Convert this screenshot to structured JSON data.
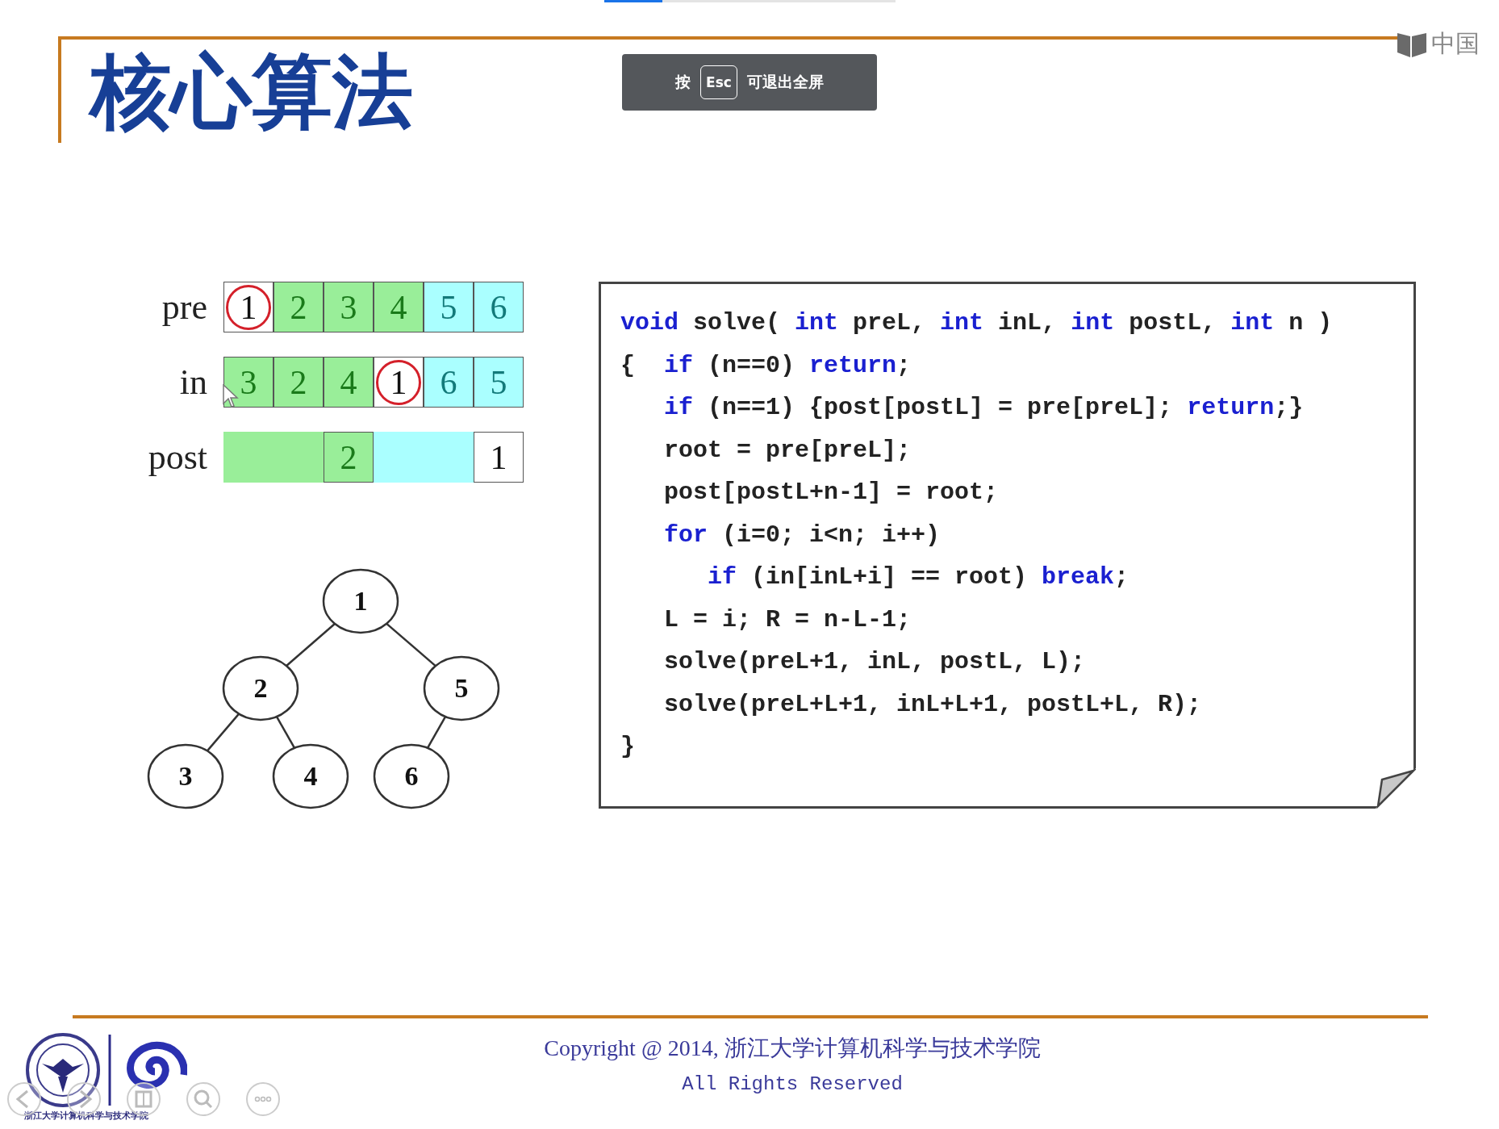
{
  "top_bar": {
    "level": 0.2
  },
  "fullscreen_hint": {
    "before": "按",
    "key": "Esc",
    "after": "可退出全屏"
  },
  "corner_logo": {
    "text": "中国"
  },
  "slide": {
    "title": "核心算法",
    "arrays": [
      {
        "label": "pre",
        "cells": [
          {
            "text": "1",
            "color": "#ffffff",
            "circled": true,
            "bordered": true
          },
          {
            "text": "2",
            "color": "#99ee99",
            "circled": false,
            "bordered": true
          },
          {
            "text": "3",
            "color": "#99ee99",
            "circled": false,
            "bordered": true
          },
          {
            "text": "4",
            "color": "#99ee99",
            "circled": false,
            "bordered": true
          },
          {
            "text": "5",
            "color": "#aaffff",
            "circled": false,
            "bordered": true
          },
          {
            "text": "6",
            "color": "#aaffff",
            "circled": false,
            "bordered": true
          }
        ]
      },
      {
        "label": "in",
        "cells": [
          {
            "text": "3",
            "color": "#99ee99",
            "circled": false,
            "bordered": true
          },
          {
            "text": "2",
            "color": "#99ee99",
            "circled": false,
            "bordered": true
          },
          {
            "text": "4",
            "color": "#99ee99",
            "circled": false,
            "bordered": true
          },
          {
            "text": "1",
            "color": "#ffffff",
            "circled": true,
            "bordered": true
          },
          {
            "text": "6",
            "color": "#aaffff",
            "circled": false,
            "bordered": true
          },
          {
            "text": "5",
            "color": "#aaffff",
            "circled": false,
            "bordered": true
          }
        ]
      },
      {
        "label": "post",
        "cells": [
          {
            "color": "#99ee99",
            "circled": false,
            "bordered": false
          },
          {
            "color": "#99ee99",
            "circled": false,
            "bordered": false
          },
          {
            "text": "2",
            "color": "#99ee99",
            "circled": false,
            "bordered": true
          },
          {
            "color": "#aaffff",
            "circled": false,
            "bordered": false
          },
          {
            "color": "#aaffff",
            "circled": false,
            "bordered": false
          },
          {
            "text": "1",
            "color": "#ffffff",
            "circled": false,
            "bordered": true
          }
        ]
      }
    ],
    "tree": {
      "text": "1",
      "children": [
        {
          "text": "2",
          "children": [
            {
              "text": "3"
            },
            {
              "text": "4"
            }
          ]
        },
        {
          "text": "5",
          "children": [
            {
              "text": "6"
            }
          ]
        }
      ]
    },
    "code": {
      "lines": [
        [
          {
            "text": "void",
            "kind": "keyword"
          },
          {
            "text": " solve( ",
            "kind": "plain"
          },
          {
            "text": "int",
            "kind": "keyword"
          },
          {
            "text": " preL, ",
            "kind": "plain"
          },
          {
            "text": "int",
            "kind": "keyword"
          },
          {
            "text": " inL, ",
            "kind": "plain"
          },
          {
            "text": "int",
            "kind": "keyword"
          },
          {
            "text": " postL, ",
            "kind": "plain"
          },
          {
            "text": "int",
            "kind": "keyword"
          },
          {
            "text": " n )",
            "kind": "plain"
          }
        ],
        [
          {
            "text": "{  ",
            "kind": "plain"
          },
          {
            "text": "if",
            "kind": "keyword"
          },
          {
            "text": " (n==0) ",
            "kind": "plain"
          },
          {
            "text": "return",
            "kind": "keyword"
          },
          {
            "text": ";",
            "kind": "plain"
          }
        ],
        [
          {
            "text": "   if",
            "kind": "keyword"
          },
          {
            "text": " (n==1) {post[postL] = pre[preL]; ",
            "kind": "plain"
          },
          {
            "text": "return",
            "kind": "keyword"
          },
          {
            "text": ";}",
            "kind": "plain"
          }
        ],
        [
          {
            "text": "   root = pre[preL];",
            "kind": "plain"
          }
        ],
        [
          {
            "text": "   post[postL+n-1] = root;",
            "kind": "plain"
          }
        ],
        [
          {
            "text": "   for",
            "kind": "keyword"
          },
          {
            "text": " (i=0; i<n; i++)",
            "kind": "plain"
          }
        ],
        [
          {
            "text": "      if",
            "kind": "keyword"
          },
          {
            "text": " (in[inL+i] == root) ",
            "kind": "plain"
          },
          {
            "text": "break",
            "kind": "keyword"
          },
          {
            "text": ";",
            "kind": "plain"
          }
        ],
        [
          {
            "text": "   L = i; R = n-L-1;",
            "kind": "plain"
          }
        ],
        [
          {
            "text": "   solve(preL+1, inL, postL, L);",
            "kind": "plain"
          }
        ],
        [
          {
            "text": "   solve(preL+L+1, inL+L+1, postL+L, R);",
            "kind": "plain"
          }
        ],
        [
          {
            "text": "}",
            "kind": "plain"
          }
        ]
      ]
    },
    "footer": {
      "logo_caption": "浙江大学计算机科学与技术学院",
      "copyright": "Copyright @ 2014, 浙江大学计算机科学与技术学院",
      "rights": "All Rights Reserved"
    }
  },
  "player_controls": [
    {
      "kind": "prev"
    },
    {
      "kind": "next"
    },
    {
      "kind": "pages"
    },
    {
      "kind": "zoom"
    },
    {
      "kind": "more"
    }
  ]
}
